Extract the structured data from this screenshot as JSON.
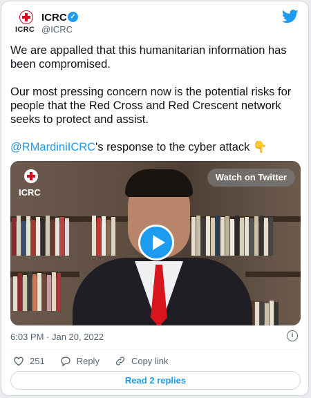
{
  "author": {
    "logo_text": "ICRC",
    "name": "ICRC",
    "handle": "@ICRC"
  },
  "tweet": {
    "para1": "We are appalled that this humanitarian information has been compromised.",
    "para2": "Our most pressing concern now is the potential risks for people that the Red Cross and Red Crescent network seeks to protect and assist.",
    "mention": "@RMardiniICRC",
    "para3_rest": "'s response to the cyber attack 👇"
  },
  "video": {
    "logo_text": "ICRC",
    "watch_label": "Watch on Twitter"
  },
  "meta": {
    "timestamp": "6:03 PM · Jan 20, 2022"
  },
  "actions": {
    "likes": "251",
    "reply_label": "Reply",
    "copy_label": "Copy link"
  },
  "replies_button": "Read 2 replies",
  "colors": {
    "accent": "#1d9bf0",
    "text": "#0f1419",
    "secondary": "#536471"
  }
}
